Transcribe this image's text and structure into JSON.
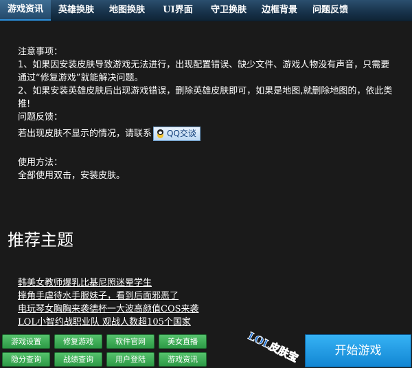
{
  "tabs": [
    {
      "label": "游戏资讯",
      "active": true
    },
    {
      "label": "英雄换肤"
    },
    {
      "label": "地图换肤"
    },
    {
      "label": "UI界面"
    },
    {
      "label": "守卫换肤"
    },
    {
      "label": "边框背景"
    },
    {
      "label": "问题反馈"
    }
  ],
  "notice": {
    "heading": "注意事项：",
    "item1": "1、如果因安装皮肤导致游戏无法进行，出现配置错误、缺少文件、游戏人物没有声音，只需要通过“修复游戏”就能解决问题。",
    "item2": "2、如果安装英雄皮肤后出现游戏错误，删除英雄皮肤即可，如果是地图,就删除地图的，依此类推!",
    "feedback_heading": "问题反馈：",
    "contact_text": "若出现皮肤不显示的情况，请联系",
    "qq_button": "QQ交谈",
    "usage_heading": "使用方法：",
    "usage_text": "全部使用双击，安装皮肤。"
  },
  "recommend": {
    "title": "推荐主题",
    "links": [
      "韩美女教师爆乳比基尼照迷晕学生",
      "摔角手虐待水手服妹子，看到后面邪恶了",
      "电玩琴女胸胸来袭德杯一大波高颜值COS来袭",
      "LOL小智约战职业队  观战人数超105个国家"
    ]
  },
  "buttons": [
    "游戏设置",
    "修复游戏",
    "软件官网",
    "美女直播",
    "隐分查询",
    "战绩查询",
    "用户登陆",
    "游戏资讯"
  ],
  "logo_text": "LOL皮肤宝贝",
  "start_button": "开始游戏",
  "colors": {
    "background": "#1a1a1a",
    "tab_bar": "#17324a",
    "green_button": "#2d9a46",
    "start_button": "#1286d3",
    "logo": "#1d6fd1"
  }
}
